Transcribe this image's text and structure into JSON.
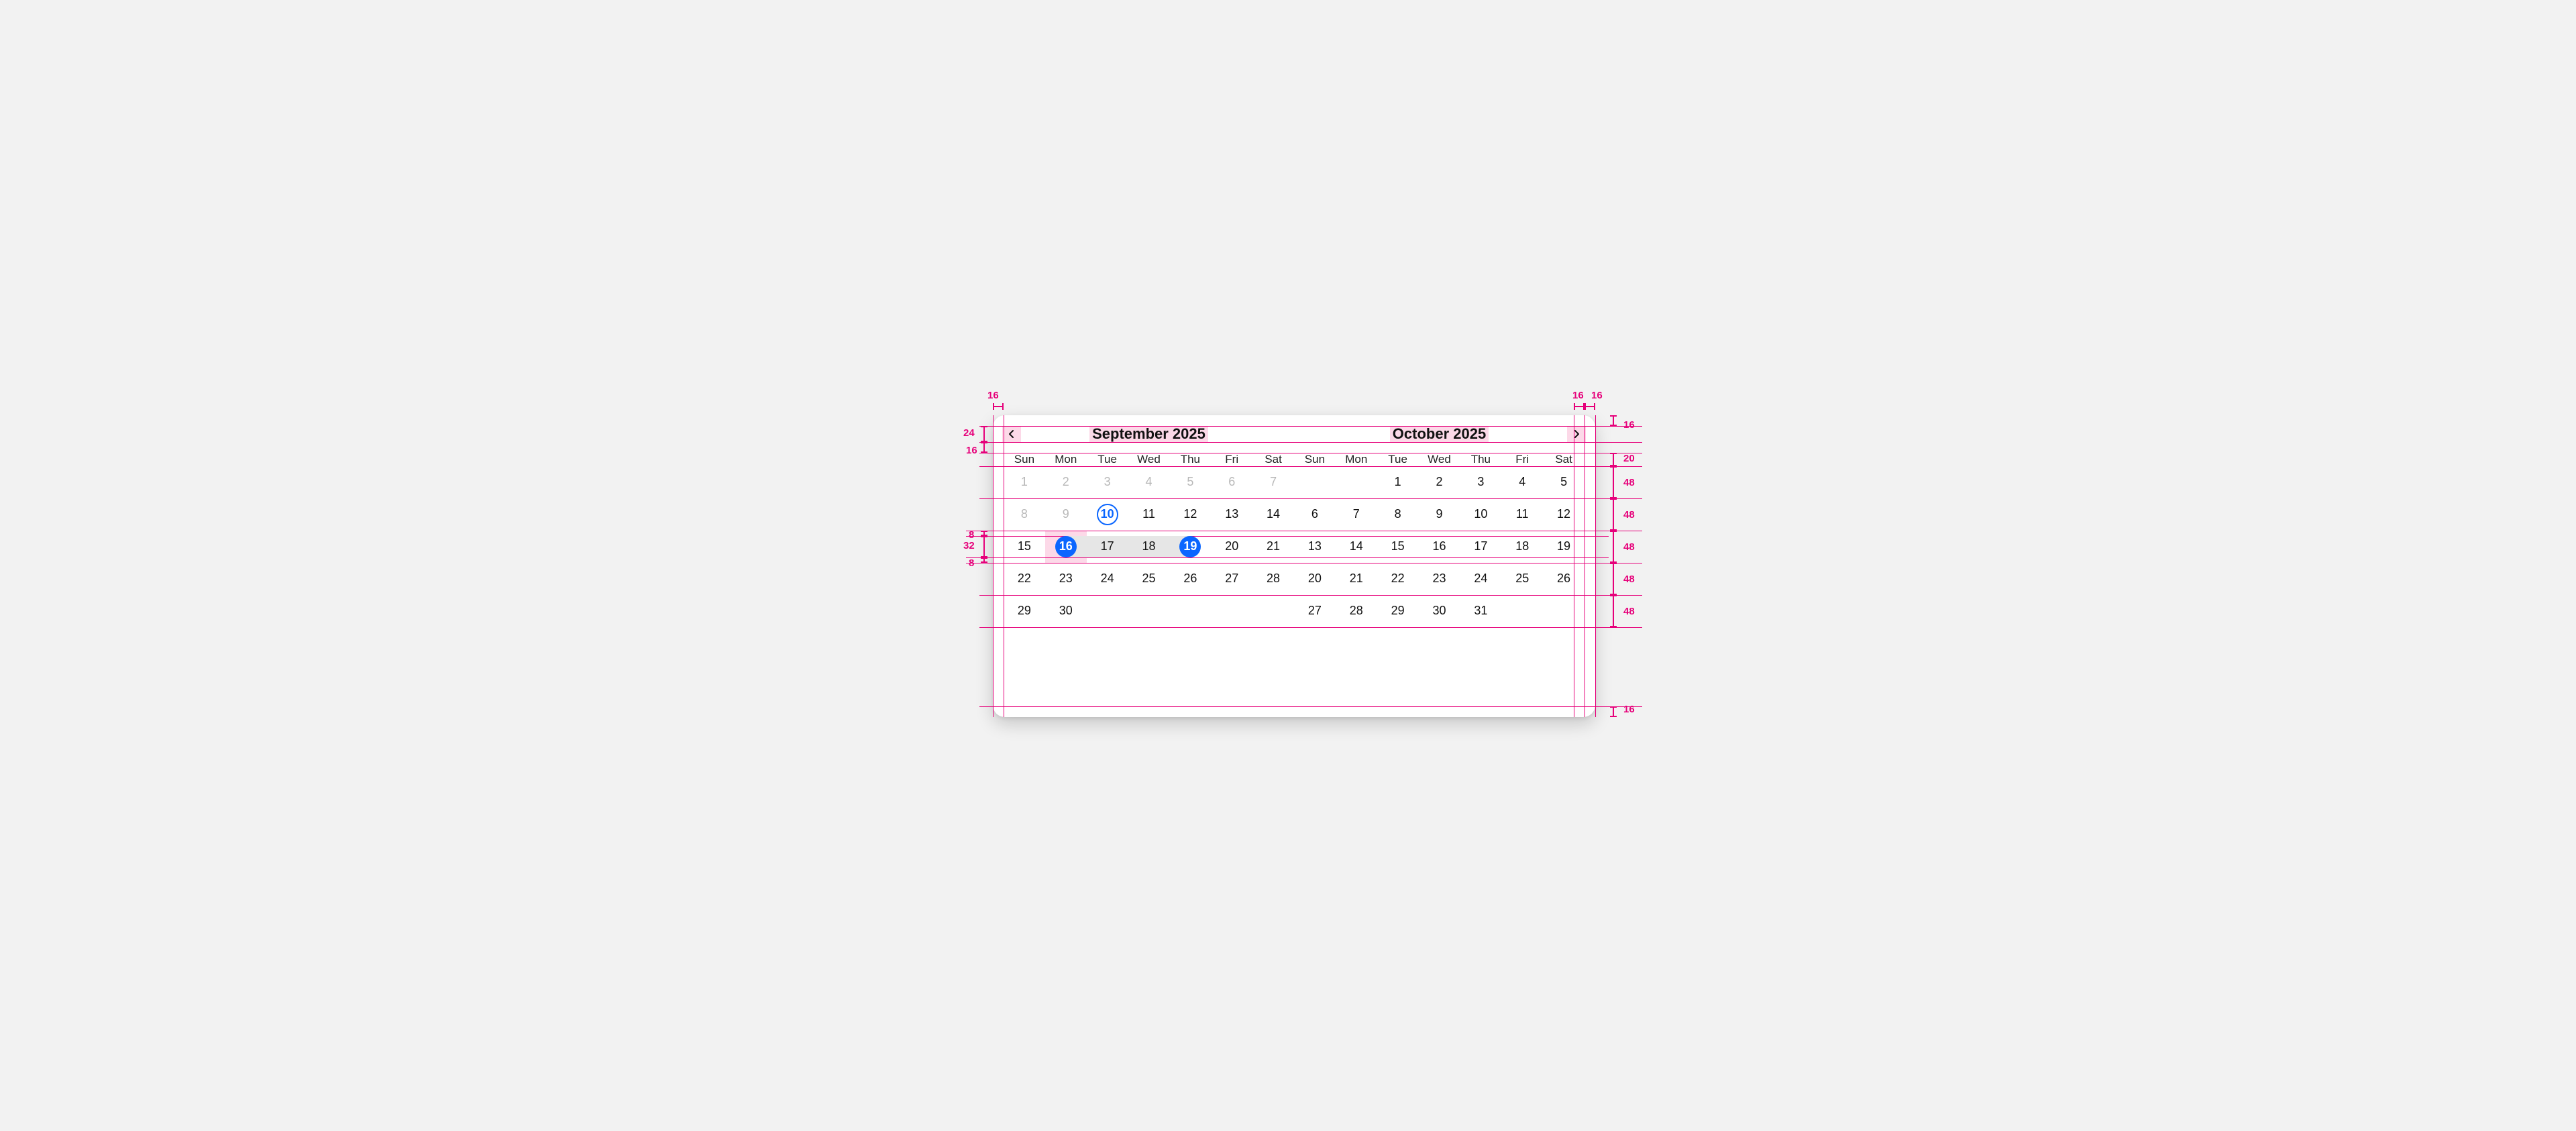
{
  "colors": {
    "accent": "#0a66ff",
    "spec": "#e6007a",
    "pink": "#fcd9e8",
    "range": "#e6e6e6"
  },
  "card": {
    "padding": 16,
    "radius": 18
  },
  "today": "2025-09-10",
  "range": {
    "start": "2025-09-16",
    "end": "2025-09-19"
  },
  "dow": [
    "Sun",
    "Mon",
    "Tue",
    "Wed",
    "Thu",
    "Fri",
    "Sat"
  ],
  "months": [
    {
      "title": "September 2025",
      "nav_prev": true,
      "weeks": [
        [
          {
            "n": "1",
            "dim": true
          },
          {
            "n": "2",
            "dim": true
          },
          {
            "n": "3",
            "dim": true
          },
          {
            "n": "4",
            "dim": true
          },
          {
            "n": "5",
            "dim": true
          },
          {
            "n": "6",
            "dim": true
          },
          {
            "n": "7",
            "dim": true
          }
        ],
        [
          {
            "n": "8",
            "dim": true
          },
          {
            "n": "9",
            "dim": true
          },
          {
            "n": "10",
            "today": true
          },
          {
            "n": "11"
          },
          {
            "n": "12"
          },
          {
            "n": "13"
          },
          {
            "n": "14"
          }
        ],
        [
          {
            "n": "15"
          },
          {
            "n": "16",
            "endpoint": "start"
          },
          {
            "n": "17",
            "in_range": true
          },
          {
            "n": "18",
            "in_range": true
          },
          {
            "n": "19",
            "endpoint": "end"
          },
          {
            "n": "20"
          },
          {
            "n": "21"
          }
        ],
        [
          {
            "n": "22"
          },
          {
            "n": "23"
          },
          {
            "n": "24"
          },
          {
            "n": "25"
          },
          {
            "n": "26"
          },
          {
            "n": "27"
          },
          {
            "n": "28"
          }
        ],
        [
          {
            "n": "29"
          },
          {
            "n": "30"
          },
          {
            "n": ""
          },
          {
            "n": ""
          },
          {
            "n": ""
          },
          {
            "n": ""
          },
          {
            "n": ""
          }
        ]
      ]
    },
    {
      "title": "October 2025",
      "nav_next": true,
      "weeks": [
        [
          {
            "n": ""
          },
          {
            "n": ""
          },
          {
            "n": ""
          },
          {
            "n": "1"
          },
          {
            "n": "2"
          },
          {
            "n": "3"
          },
          {
            "n": "4"
          },
          {
            "n": "5"
          }
        ],
        [
          {
            "n": "6"
          },
          {
            "n": "7"
          },
          {
            "n": "8"
          },
          {
            "n": "9"
          },
          {
            "n": "10"
          },
          {
            "n": "11"
          },
          {
            "n": "12"
          }
        ],
        [
          {
            "n": "13"
          },
          {
            "n": "14"
          },
          {
            "n": "15"
          },
          {
            "n": "16"
          },
          {
            "n": "17"
          },
          {
            "n": "18"
          },
          {
            "n": "19"
          }
        ],
        [
          {
            "n": "20"
          },
          {
            "n": "21"
          },
          {
            "n": "22"
          },
          {
            "n": "23"
          },
          {
            "n": "24"
          },
          {
            "n": "25"
          },
          {
            "n": "26"
          }
        ],
        [
          {
            "n": "27"
          },
          {
            "n": "28"
          },
          {
            "n": "29"
          },
          {
            "n": "30"
          },
          {
            "n": "31"
          },
          {
            "n": ""
          },
          {
            "n": ""
          }
        ]
      ]
    }
  ],
  "annotations": {
    "top": {
      "left_pad": "16",
      "right_pad_a": "16",
      "right_pad_b": "16"
    },
    "left": {
      "header_h": "24",
      "header_gap": "16",
      "row_pad_top": "8",
      "row_inner_h": "32",
      "row_pad_bottom": "8"
    },
    "right": {
      "card_top_pad": "16",
      "dow_h": "20",
      "row_h": [
        "48",
        "48",
        "48",
        "48",
        "48"
      ],
      "card_bottom_pad": "16"
    }
  }
}
